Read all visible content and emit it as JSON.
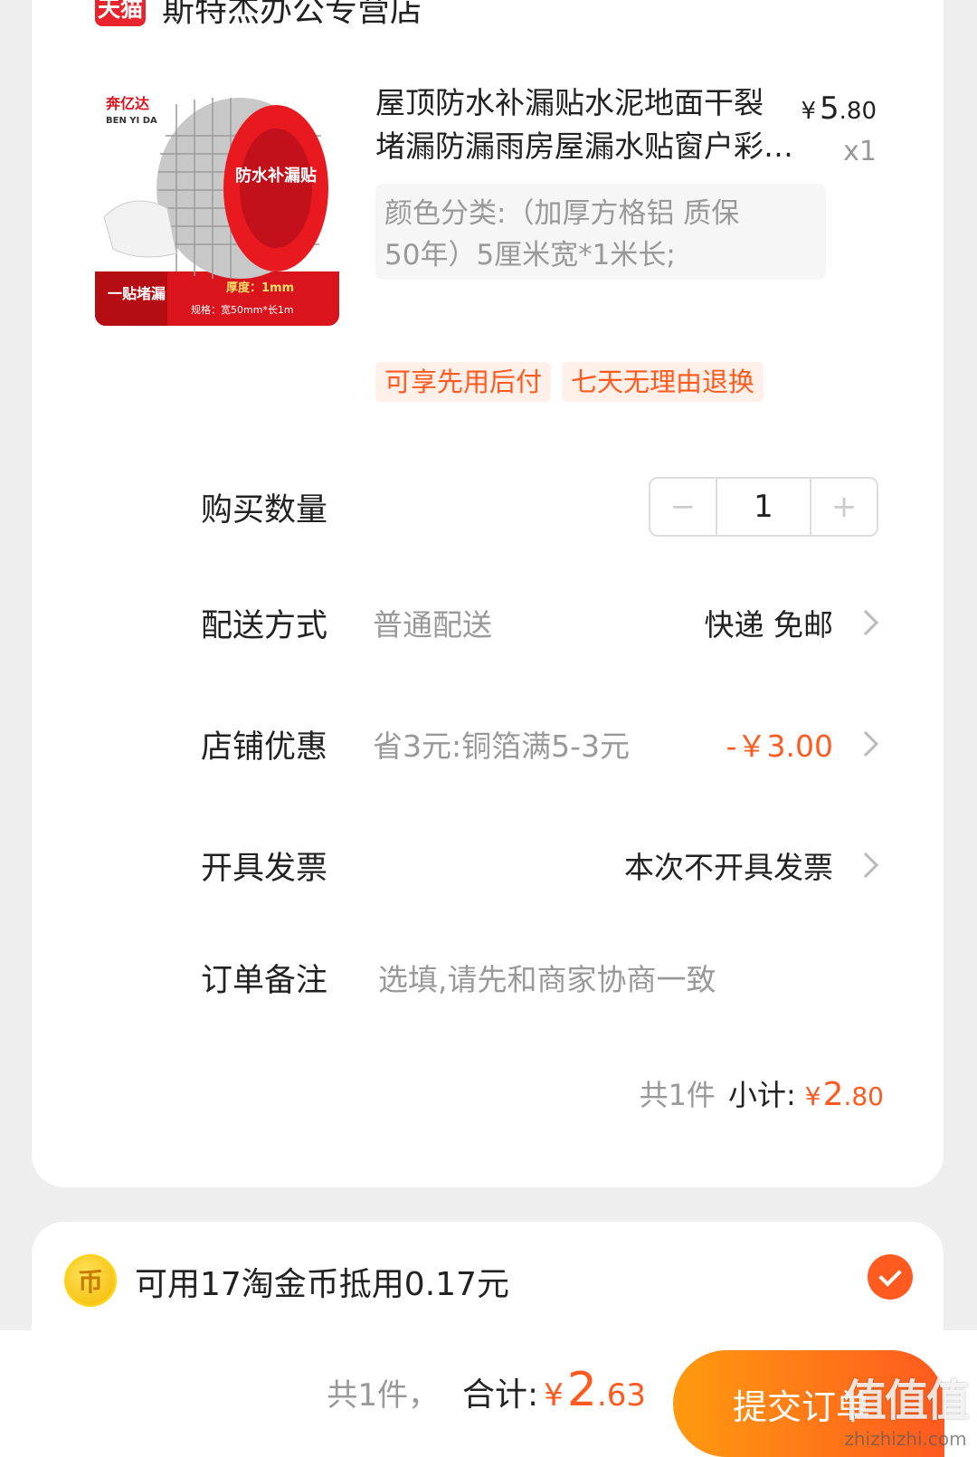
{
  "shop": {
    "badge": "天猫",
    "name": "斯特杰办公专营店"
  },
  "product": {
    "image_alt": "奔亿达 防水补漏贴",
    "image_text": {
      "brand": "奔亿达",
      "brand_en": "BEN YI DA",
      "roll_title": "防水补漏贴",
      "corner": "一贴堵漏",
      "thickness": "厚度：1mm",
      "spec": "规格：宽50mm*长1m"
    },
    "title_line1": "屋顶防水补漏贴水泥地面干裂",
    "title_line2": "堵漏防漏雨房屋漏水贴窗户彩…",
    "price_currency": "¥",
    "price_int": "5",
    "price_dec": ".80",
    "quantity_label": "x1",
    "sku_line1": "颜色分类:（加厚方格铝 质保",
    "sku_line2": "50年）5厘米宽*1米长;"
  },
  "tags": [
    "可享先用后付",
    "七天无理由退换"
  ],
  "quantity": {
    "label": "购买数量",
    "minus": "−",
    "value": "1",
    "plus": "+"
  },
  "delivery": {
    "label": "配送方式",
    "sub": "普通配送",
    "value": "快递 免邮"
  },
  "discount": {
    "label": "店铺优惠",
    "sub": "省3元:铜箔满5-3元",
    "value": "-￥3.00"
  },
  "invoice": {
    "label": "开具发票",
    "value": "本次不开具发票"
  },
  "note": {
    "label": "订单备注",
    "placeholder": "选填,请先和商家协商一致"
  },
  "subtotal": {
    "count": "共1件",
    "label": "小计:",
    "currency": "¥",
    "int": "2",
    "dec": ".80"
  },
  "coins": {
    "icon_glyph": "币",
    "text": "可用17淘金币抵用0.17元",
    "checked": true
  },
  "footer": {
    "count": "共1件，",
    "label": "合计:",
    "currency": "¥",
    "int": "2",
    "dec": ".63",
    "submit": "提交订单",
    "watermark": "值值值",
    "watermark_url": "zhizhizhi.com"
  },
  "colors": {
    "accent": "#ff5a1f",
    "tmall_red": "#e8242c",
    "gradient_start": "#ff9a10"
  }
}
